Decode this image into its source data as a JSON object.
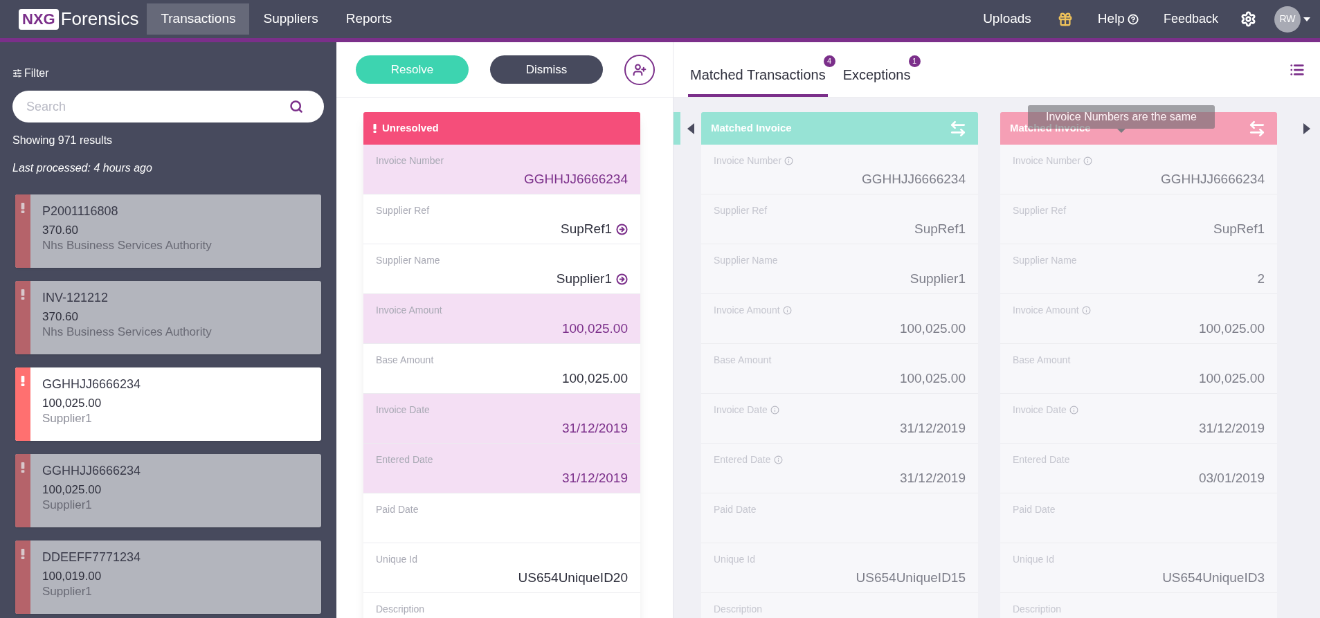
{
  "brand": {
    "logo_box": "NXG",
    "name": "Forensics"
  },
  "nav": [
    {
      "label": "Transactions",
      "selected": true
    },
    {
      "label": "Suppliers",
      "selected": false
    },
    {
      "label": "Reports",
      "selected": false
    }
  ],
  "header_right": {
    "uploads": "Uploads",
    "help": "Help",
    "feedback": "Feedback",
    "avatar": "RW"
  },
  "sidebar": {
    "filter": "Filter",
    "search": {
      "placeholder": "Search"
    },
    "results": "Showing 971 results",
    "last_processed": "Last processed: 4 hours ago",
    "items": [
      {
        "ref": "P2001116808",
        "amount": "370.60",
        "supplier": "Nhs Business Services Authority",
        "selected": false
      },
      {
        "ref": "INV-121212",
        "amount": "370.60",
        "supplier": "Nhs Business Services Authority",
        "selected": false
      },
      {
        "ref": "GGHHJJ6666234",
        "amount": "100,025.00",
        "supplier": "Supplier1",
        "selected": true
      },
      {
        "ref": "GGHHJJ6666234",
        "amount": "100,025.00",
        "supplier": "Supplier1",
        "selected": false
      },
      {
        "ref": "DDEEFF7771234",
        "amount": "100,019.00",
        "supplier": "Supplier1",
        "selected": false
      }
    ]
  },
  "actions": [
    {
      "label": "Resolve",
      "kind": "primary"
    },
    {
      "label": "Dismiss",
      "kind": "secondary"
    }
  ],
  "tabs": [
    {
      "label": "Matched Transactions",
      "badge": "4",
      "selected": true
    },
    {
      "label": "Exceptions",
      "badge": "1",
      "selected": false
    }
  ],
  "unresolved_card": {
    "status": "Unresolved",
    "fields": [
      {
        "label": "Invoice Number",
        "value": "GGHHJJ6666234",
        "highlighted": true,
        "link": false
      },
      {
        "label": "Supplier Ref",
        "value": "SupRef1",
        "highlighted": false,
        "link": true
      },
      {
        "label": "Supplier Name",
        "value": "Supplier1",
        "highlighted": false,
        "link": true
      },
      {
        "label": "Invoice Amount",
        "value": "100,025.00",
        "highlighted": true,
        "link": false
      },
      {
        "label": "Base Amount",
        "value": "100,025.00",
        "highlighted": false,
        "link": false
      },
      {
        "label": "Invoice Date",
        "value": "31/12/2019",
        "highlighted": true,
        "link": false
      },
      {
        "label": "Entered Date",
        "value": "31/12/2019",
        "highlighted": true,
        "link": false
      },
      {
        "label": "Paid Date",
        "highlighted": false,
        "link": false
      },
      {
        "label": "Unique Id",
        "value": "US654UniqueID20",
        "highlighted": false,
        "link": false
      },
      {
        "label": "Description",
        "highlighted": false,
        "link": false
      }
    ]
  },
  "matched_cards": [
    {
      "title": "Matched Invoice",
      "color": "#97e3d5",
      "fields": [
        {
          "label": "Invoice Number",
          "value": "GGHHJJ6666234",
          "info": true
        },
        {
          "label": "Supplier Ref",
          "value": "SupRef1",
          "info": false
        },
        {
          "label": "Supplier Name",
          "value": "Supplier1",
          "info": false
        },
        {
          "label": "Invoice Amount",
          "value": "100,025.00",
          "info": true
        },
        {
          "label": "Base Amount",
          "value": "100,025.00",
          "info": false
        },
        {
          "label": "Invoice Date",
          "value": "31/12/2019",
          "info": true
        },
        {
          "label": "Entered Date",
          "value": "31/12/2019",
          "info": true
        },
        {
          "label": "Paid Date",
          "info": false
        },
        {
          "label": "Unique Id",
          "value": "US654UniqueID15",
          "info": false
        },
        {
          "label": "Description",
          "info": false
        }
      ]
    },
    {
      "title": "Matched Invoice",
      "color": "#f59fb5",
      "tooltip": "Invoice Numbers are the same",
      "fields": [
        {
          "label": "Invoice Number",
          "value": "GGHHJJ6666234",
          "info": true
        },
        {
          "label": "Supplier Ref",
          "value": "SupRef1",
          "info": false
        },
        {
          "label": "Supplier Name",
          "value": "2",
          "info": false
        },
        {
          "label": "Invoice Amount",
          "value": "100,025.00",
          "info": true
        },
        {
          "label": "Base Amount",
          "value": "100,025.00",
          "info": false
        },
        {
          "label": "Invoice Date",
          "value": "31/12/2019",
          "info": true
        },
        {
          "label": "Entered Date",
          "value": "03/01/2019",
          "info": false
        },
        {
          "label": "Paid Date",
          "info": false
        },
        {
          "label": "Unique Id",
          "value": "US654UniqueID3",
          "info": false
        },
        {
          "label": "Description",
          "info": false
        }
      ]
    }
  ]
}
